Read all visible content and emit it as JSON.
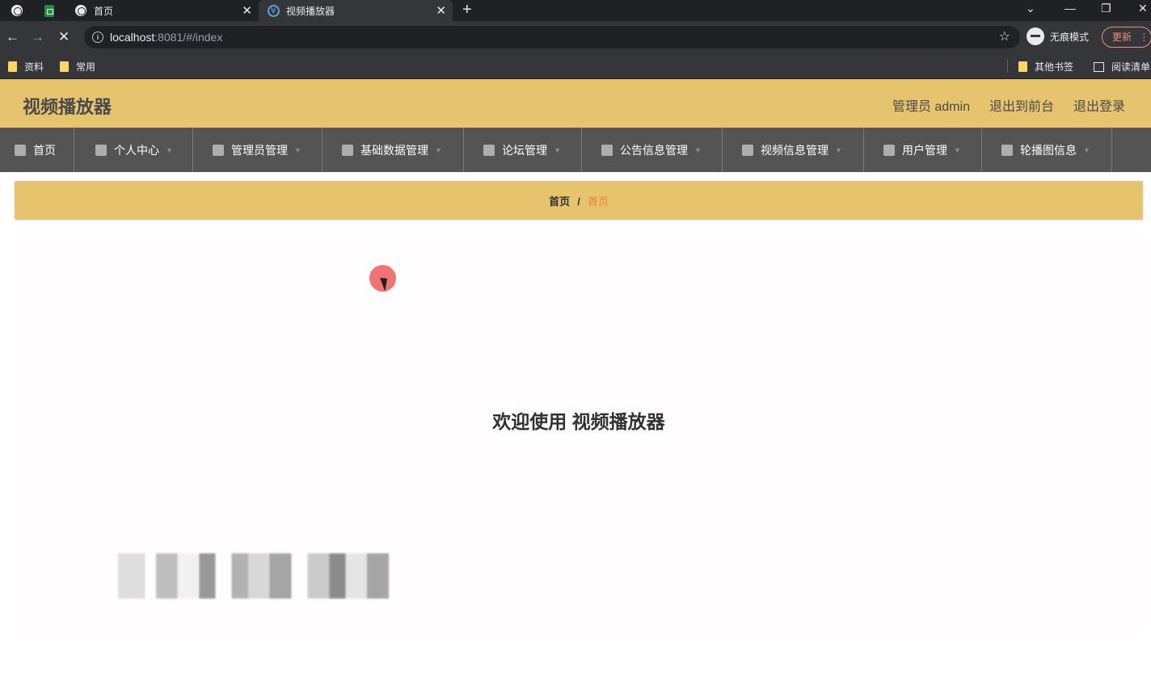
{
  "browser": {
    "tabs": [
      {
        "label": "首页",
        "icon": "globe-icon"
      },
      {
        "label": "视频播放器",
        "icon": "v-logo-icon",
        "active": true
      }
    ],
    "url_host": "localhost",
    "url_rest": ":8081/#/index",
    "profile_label": "无痕模式",
    "update_label": "更新",
    "bookmarks": [
      {
        "label": "资料"
      },
      {
        "label": "常用"
      }
    ],
    "bookmarks_right": [
      {
        "label": "其他书签"
      },
      {
        "label": "阅读清单"
      }
    ]
  },
  "header": {
    "title": "视频播放器",
    "admin_label": "管理员 admin",
    "front_label": "退出到前台",
    "logout_label": "退出登录"
  },
  "nav": {
    "items": [
      {
        "label": "首页"
      },
      {
        "label": "个人中心"
      },
      {
        "label": "管理员管理"
      },
      {
        "label": "基础数据管理"
      },
      {
        "label": "论坛管理"
      },
      {
        "label": "公告信息管理"
      },
      {
        "label": "视频信息管理"
      },
      {
        "label": "用户管理"
      },
      {
        "label": "轮播图信息"
      }
    ]
  },
  "breadcrumb": {
    "root": "首页",
    "separator": "/",
    "current": "首页"
  },
  "main": {
    "welcome": "欢迎使用 视频播放器"
  },
  "colors": {
    "accent": "#e6c46e",
    "nav_bg": "#545454",
    "breadcrumb_current": "#f08030"
  }
}
